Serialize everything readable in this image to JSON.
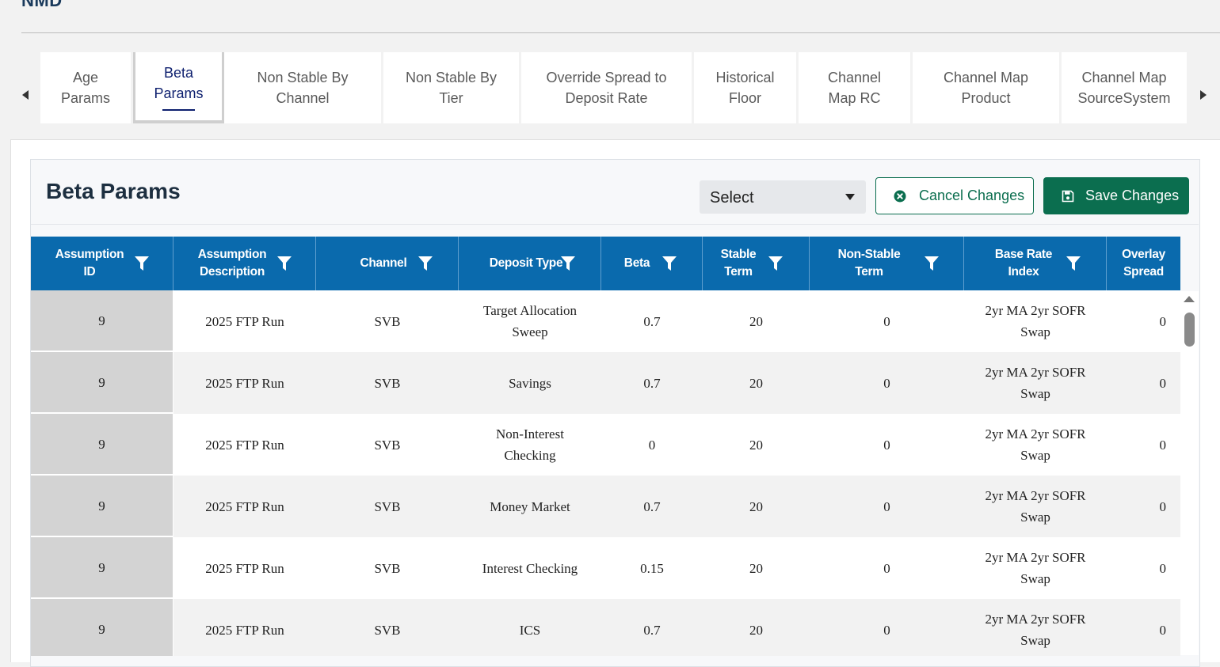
{
  "page": {
    "title": "NMD"
  },
  "tabs": [
    {
      "label": "Age Params",
      "active": false
    },
    {
      "label": "Beta Params",
      "active": true
    },
    {
      "label": "Non Stable By Channel",
      "active": false
    },
    {
      "label": "Non Stable By Tier",
      "active": false
    },
    {
      "label": "Override Spread to Deposit Rate",
      "active": false
    },
    {
      "label": "Historical Floor",
      "active": false
    },
    {
      "label": "Channel Map RC",
      "active": false
    },
    {
      "label": "Channel Map Product",
      "active": false
    },
    {
      "label": "Channel Map SourceSystem",
      "active": false
    }
  ],
  "tab_icons": {
    "prev": "caret-left-icon",
    "next": "caret-right-icon"
  },
  "card": {
    "title": "Beta Params",
    "select": {
      "value": "Select"
    },
    "cancel_label": "Cancel Changes",
    "save_label": "Save Changes",
    "cancel_icon": "x-circle-icon",
    "save_icon": "floppy-disk-icon"
  },
  "colors": {
    "header_bg": "#0a6aad",
    "primary_green": "#0b6e4f",
    "active_tab_text": "#0d1f6e"
  },
  "table": {
    "columns": [
      {
        "label": "Assumption ID",
        "lines": [
          "Assumption",
          "ID"
        ],
        "filter_icon": "filter-icon"
      },
      {
        "label": "Assumption Description",
        "lines": [
          "Assumption",
          "Description"
        ],
        "filter_icon": "filter-icon"
      },
      {
        "label": "Channel",
        "lines": [
          "Channel"
        ],
        "filter_icon": "filter-icon"
      },
      {
        "label": "Deposit Type",
        "lines": [
          "Deposit Type"
        ],
        "filter_icon": "filter-icon"
      },
      {
        "label": "Beta",
        "lines": [
          "Beta"
        ],
        "filter_icon": "filter-icon"
      },
      {
        "label": "Stable Term",
        "lines": [
          "Stable",
          "Term"
        ],
        "filter_icon": "filter-icon"
      },
      {
        "label": "Non-Stable Term",
        "lines": [
          "Non-Stable",
          "Term"
        ],
        "filter_icon": "filter-icon"
      },
      {
        "label": "Base Rate Index",
        "lines": [
          "Base Rate",
          "Index"
        ],
        "filter_icon": "filter-icon"
      },
      {
        "label": "Overlay Spread",
        "lines": [
          "Overlay",
          "Spread"
        ],
        "filter_icon": null
      }
    ],
    "rows": [
      [
        "9",
        "2025 FTP Run",
        "SVB",
        "Target Allocation Sweep",
        "0.7",
        "20",
        "0",
        "2yr MA 2yr SOFR Swap",
        "0"
      ],
      [
        "9",
        "2025 FTP Run",
        "SVB",
        "Savings",
        "0.7",
        "20",
        "0",
        "2yr MA 2yr SOFR Swap",
        "0"
      ],
      [
        "9",
        "2025 FTP Run",
        "SVB",
        "Non-Interest Checking",
        "0",
        "20",
        "0",
        "2yr MA 2yr SOFR Swap",
        "0"
      ],
      [
        "9",
        "2025 FTP Run",
        "SVB",
        "Money Market",
        "0.7",
        "20",
        "0",
        "2yr MA 2yr SOFR Swap",
        "0"
      ],
      [
        "9",
        "2025 FTP Run",
        "SVB",
        "Interest Checking",
        "0.15",
        "20",
        "0",
        "2yr MA 2yr SOFR Swap",
        "0"
      ],
      [
        "9",
        "2025 FTP Run",
        "SVB",
        "ICS",
        "0.7",
        "20",
        "0",
        "2yr MA 2yr SOFR Swap",
        "0"
      ]
    ]
  }
}
